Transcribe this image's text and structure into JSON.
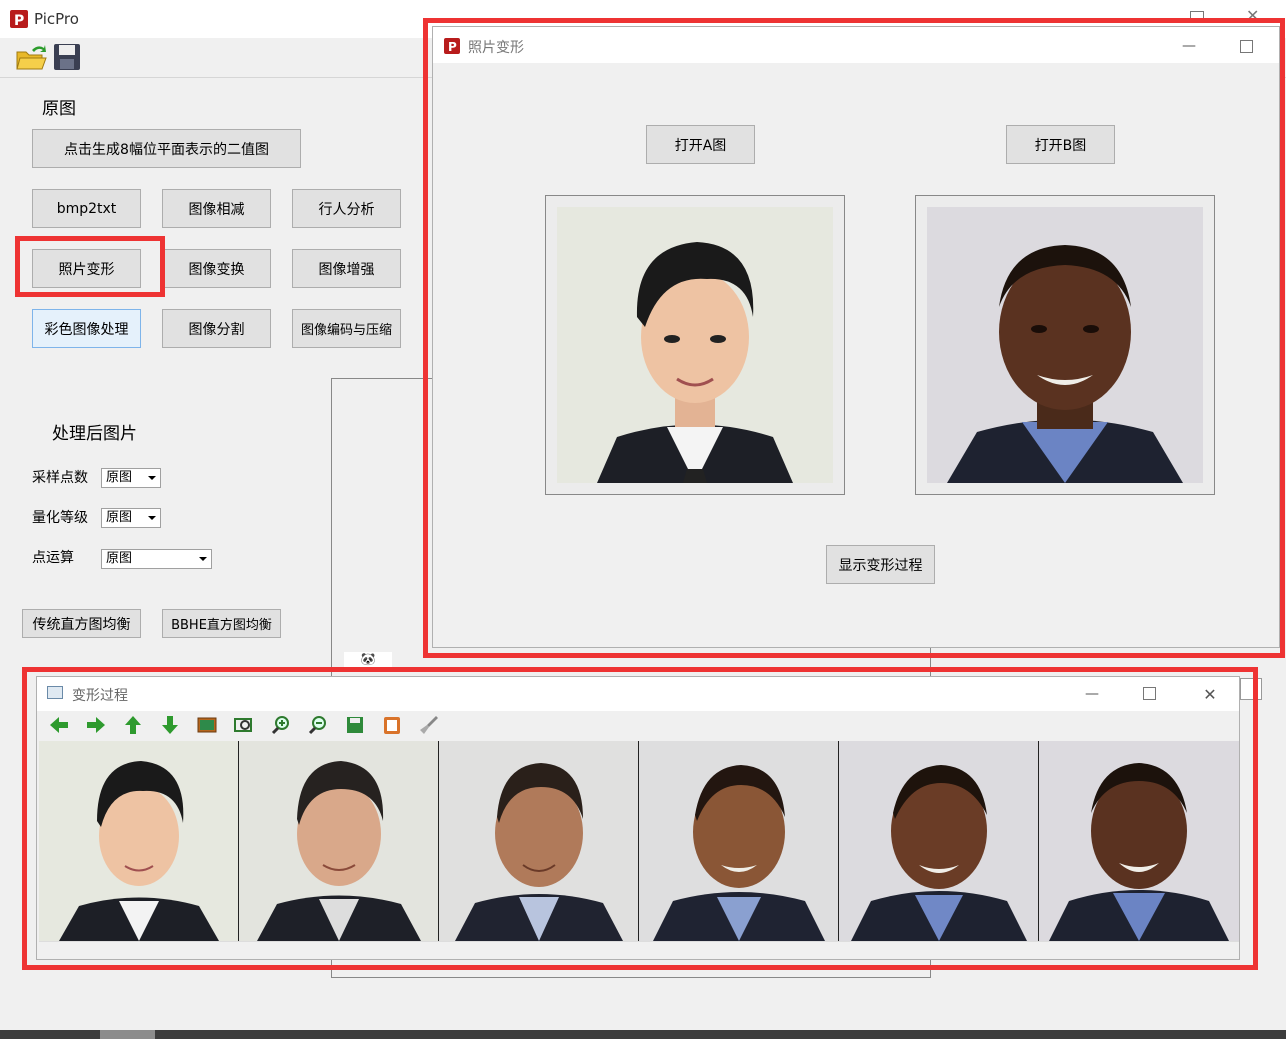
{
  "main_window": {
    "title": "PicPro",
    "original_label": "原图",
    "btn_bitplanes": "点击生成8幅位平面表示的二值图",
    "buttons_row1": [
      "bmp2txt",
      "图像相减",
      "行人分析"
    ],
    "buttons_row2": [
      "照片变形",
      "图像变换",
      "图像增强"
    ],
    "buttons_row3": [
      "彩色图像处理",
      "图像分割",
      "图像编码与压缩"
    ],
    "processed_label": "处理后图片",
    "sampling_label": "采样点数",
    "sampling_value": "原图",
    "quant_label": "量化等级",
    "quant_value": "原图",
    "point_label": "点运算",
    "point_value": "原图",
    "btn_hist_eq": "传统直方图均衡",
    "btn_behe": "BBHE直方图均衡"
  },
  "morph_window": {
    "title": "照片变形",
    "btn_open_a": "打开A图",
    "btn_open_b": "打开B图",
    "btn_show_process": "显示变形过程"
  },
  "process_window": {
    "title": "变形过程",
    "toolbar_icons": [
      "arrow-left-icon",
      "arrow-right-icon",
      "arrow-up-icon",
      "arrow-down-icon",
      "image-icon",
      "fit-icon",
      "zoom-in-icon",
      "zoom-out-icon",
      "save-icon",
      "clipboard-icon",
      "brush-icon"
    ],
    "frames": 6
  },
  "colors": {
    "highlight_red": "#ee3333",
    "toolbar_green": "#2e9a2e"
  }
}
